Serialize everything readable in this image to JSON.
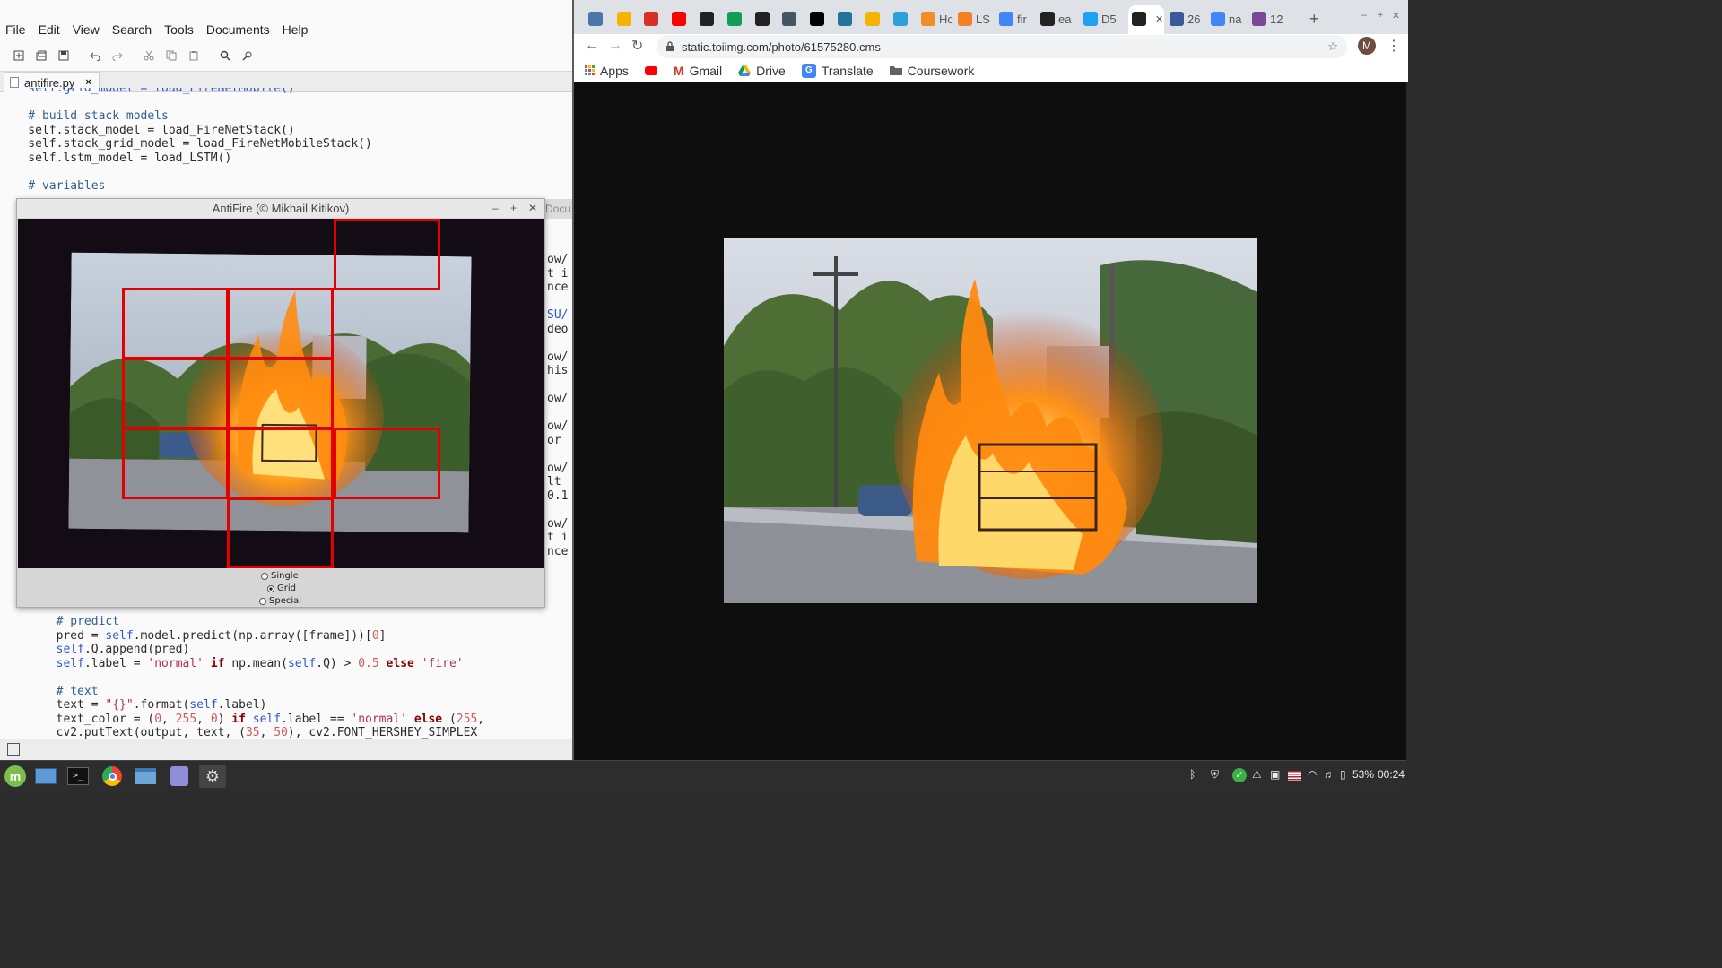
{
  "editor": {
    "menu": [
      "File",
      "Edit",
      "View",
      "Search",
      "Tools",
      "Documents",
      "Help"
    ],
    "tab_label": "antifire.py",
    "code_top": [
      "    self.grid_model = load_FireNetMobile()",
      "",
      "    # build stack models",
      "    self.stack_model = load_FireNetStack()",
      "    self.stack_grid_model = load_FireNetMobileStack()",
      "    self.lstm_model = load_LSTM()",
      "",
      "    # variables"
    ],
    "peek_lines": [
      "ow/",
      "t i",
      "nce",
      "",
      "SU/",
      "deo",
      "",
      "ow/",
      "his",
      "",
      "ow/",
      "",
      "ow/",
      "or ",
      "",
      "ow/",
      "lt ",
      "0.1",
      "",
      "ow/",
      "t i",
      "nce"
    ],
    "peek_header": "Docu"
  },
  "antifire": {
    "title": "AntiFire (© Mikhail Kitikov)",
    "radios": [
      {
        "label": "Single",
        "selected": false
      },
      {
        "label": "Grid",
        "selected": true
      },
      {
        "label": "Special",
        "selected": false
      }
    ]
  },
  "browser": {
    "tabs": [
      {
        "icon": "vk-icon",
        "text": "",
        "color": "#4a76a8"
      },
      {
        "icon": "drive-icon",
        "text": "",
        "color": "#f4b400"
      },
      {
        "icon": "gmail-icon",
        "text": "",
        "color": "#d93025"
      },
      {
        "icon": "youtube-icon",
        "text": "",
        "color": "#ff0000"
      },
      {
        "icon": "globe-icon",
        "text": "",
        "color": "#222222"
      },
      {
        "icon": "drive-icon",
        "text": "",
        "color": "#0f9d58"
      },
      {
        "icon": "github-icon",
        "text": "",
        "color": "#222222"
      },
      {
        "icon": "doc-icon",
        "text": "",
        "color": "#445566"
      },
      {
        "icon": "notion-icon",
        "text": "",
        "color": "#000000"
      },
      {
        "icon": "wordpress-icon",
        "text": "",
        "color": "#21759b"
      },
      {
        "icon": "drive-icon",
        "text": "",
        "color": "#f4b400"
      },
      {
        "icon": "telegram-icon",
        "text": "",
        "color": "#2aa1da"
      },
      {
        "icon": "reload-icon",
        "text": "Hc",
        "color": "#f28c28"
      },
      {
        "icon": "stack-icon",
        "text": "LS",
        "color": "#f48024"
      },
      {
        "icon": "google-icon",
        "text": "fir",
        "color": "#4285f4"
      },
      {
        "icon": "globe-icon",
        "text": "ea",
        "color": "#222222"
      },
      {
        "icon": "twitter-icon",
        "text": "D5",
        "color": "#1da1f2"
      },
      {
        "icon": "globe-icon",
        "text": "",
        "color": "#222222"
      },
      {
        "icon": "f-icon",
        "text": "26",
        "color": "#3b5998"
      },
      {
        "icon": "google-icon",
        "text": "na",
        "color": "#4285f4"
      },
      {
        "icon": "tor-icon",
        "text": "12",
        "color": "#7d4698"
      }
    ],
    "url": "static.toiimg.com/photo/61575280.cms",
    "bookmarks": [
      {
        "icon": "apps-icon",
        "label": "Apps"
      },
      {
        "icon": "youtube-icon",
        "label": ""
      },
      {
        "icon": "gmail-icon",
        "label": "Gmail"
      },
      {
        "icon": "drive-icon",
        "label": "Drive"
      },
      {
        "icon": "translate-icon",
        "label": "Translate"
      },
      {
        "icon": "folder-icon",
        "label": "Coursework"
      }
    ],
    "avatar_letter": "M"
  },
  "taskbar": {
    "battery": "53%",
    "clock": "00:24"
  },
  "colors": {
    "grid_red": "#e50000",
    "editor_bg": "#fafafa",
    "taskbar_bg": "#2d2d2d"
  }
}
